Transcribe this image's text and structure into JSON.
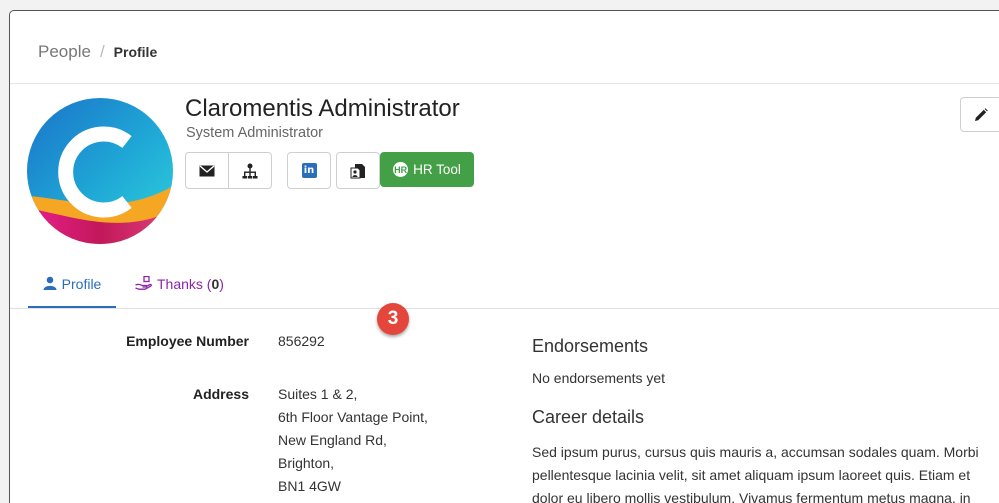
{
  "breadcrumb": {
    "root": "People",
    "separator": "/",
    "current": "Profile"
  },
  "profile": {
    "name": "Claromentis Administrator",
    "role": "System Administrator",
    "avatar_letter": "C"
  },
  "actions": {
    "email_icon": "envelope-icon",
    "org_icon": "org-chart-icon",
    "linkedin_label": "in",
    "vcard_icon": "contact-card-icon",
    "hr_tool_label": "HR Tool",
    "hr_tool_icon_text": "HR",
    "edit_icon": "pencil-icon"
  },
  "tabs": [
    {
      "label": "Profile",
      "icon": "user-icon"
    },
    {
      "label": "Thanks (",
      "count": "0",
      "suffix": ")",
      "icon": "hand-gift-icon"
    }
  ],
  "annotation_badge": "3",
  "fields": {
    "employee_number_label": "Employee Number",
    "employee_number": "856292",
    "address_label": "Address",
    "address_lines": [
      "Suites 1 & 2,",
      "6th Floor Vantage Point,",
      "New England Rd,",
      "Brighton,",
      "BN1 4GW"
    ]
  },
  "endorsements": {
    "heading": "Endorsements",
    "text": "No endorsements yet"
  },
  "career": {
    "heading": "Career details",
    "lines": [
      "Sed ipsum purus, cursus quis mauris a, accumsan sodales quam. Morbi",
      "pellentesque lacinia velit, sit amet aliquam ipsum laoreet quis. Etiam et",
      "dolor eu libero mollis vestibulum. Vivamus fermentum metus magna, in"
    ]
  },
  "colors": {
    "link_blue": "#2a6ebb",
    "thanks_purple": "#8e24aa",
    "hr_green": "#43a047",
    "badge_red": "#e4463b"
  }
}
